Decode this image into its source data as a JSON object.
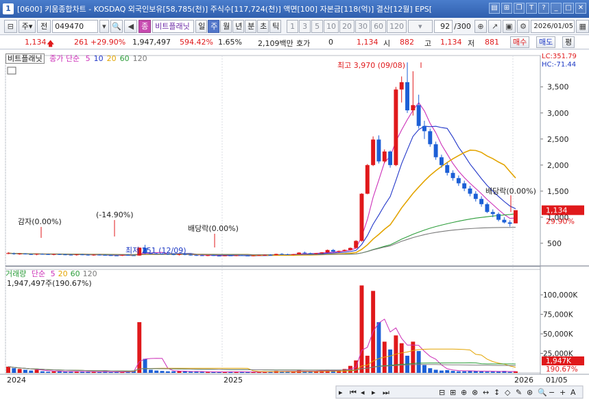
{
  "title": {
    "app_number": "1",
    "text": "[0600] 키움종합차트 - KOSDAQ 외국인보유[58,785(천)] 주식수[117,724(천)] 액면[100] 자본금[118(억)] 결산[12월] EPS["
  },
  "toolbar": {
    "market": "주",
    "prev": "전",
    "code": "049470",
    "name": "비트플래닛",
    "badge": "종",
    "periods": [
      "일",
      "주",
      "월",
      "년",
      "분",
      "초",
      "틱"
    ],
    "selected_period": "주",
    "nums": [
      "1",
      "3",
      "5",
      "10",
      "20",
      "30",
      "60",
      "120"
    ],
    "count": "92",
    "total": "/300",
    "date": "2026/01/05"
  },
  "quote": {
    "price": "1,134",
    "change": "261",
    "change_pct": "+29.90%",
    "volume": "1,947,497",
    "vol_ratio": "594.42%",
    "turnover": "1.65%",
    "amount": "2,109백만",
    "hoga": "호가",
    "hoga_val": "0",
    "ask": "1,134",
    "open_l": "시",
    "open": "882",
    "high_l": "고",
    "high": "1,134",
    "low_l": "저",
    "low": "881",
    "buy": "매수",
    "sell": "매도",
    "avg": "평"
  },
  "legend": {
    "name": "비트플래닛",
    "price_label": "종가 단순",
    "ma": [
      "5",
      "10",
      "20",
      "60",
      "120"
    ],
    "ma_colors": [
      "#cc2fb8",
      "#2237c9",
      "#e3a400",
      "#2c9d3a",
      "#7a7a7a"
    ],
    "lc": "LC:351.79",
    "hc": "HC:-71.44"
  },
  "annotations": {
    "high": "최고 3,970 (09/08)",
    "low": "최저 251 (12/09)",
    "gamja": "감자(0.00%)",
    "minus": "(-14.90%)",
    "div1": "배당락(0.00%)",
    "div2": "배당락(0.00%)"
  },
  "current": {
    "price": "1,134",
    "pct": "29.90%",
    "vol": "1,947K",
    "vol_pct": "190.67%"
  },
  "volume_legend": {
    "label": "거래량",
    "ma_label": "단순",
    "ma": [
      "5",
      "20",
      "60",
      "120"
    ],
    "ma_colors": [
      "#cc2fb8",
      "#e3a400",
      "#2c9d3a",
      "#7a7a7a"
    ],
    "value": "1,947,497주(190.67%)"
  },
  "xaxis": {
    "labels": [
      "2024",
      "2025",
      "2026"
    ],
    "last": "01/05"
  },
  "chart_data": {
    "type": "candlestick",
    "price_ticks": [
      500,
      1000,
      1500,
      2000,
      2500,
      3000,
      3500
    ],
    "ylim_price": [
      130,
      3970
    ],
    "volume_ticks": [
      "25,000K",
      "50,000K",
      "75,000K",
      "100,000K"
    ],
    "ylim_volume_k": [
      0,
      115000
    ],
    "candles": [
      [
        300,
        330,
        290,
        310
      ],
      [
        305,
        320,
        280,
        295
      ],
      [
        295,
        310,
        280,
        300
      ],
      [
        300,
        310,
        285,
        290
      ],
      [
        290,
        300,
        275,
        285
      ],
      [
        285,
        300,
        270,
        295
      ],
      [
        295,
        305,
        280,
        290
      ],
      [
        290,
        300,
        275,
        280
      ],
      [
        280,
        295,
        270,
        290
      ],
      [
        290,
        300,
        275,
        285
      ],
      [
        285,
        295,
        270,
        280
      ],
      [
        280,
        290,
        265,
        275
      ],
      [
        275,
        290,
        262,
        285
      ],
      [
        285,
        295,
        270,
        280
      ],
      [
        280,
        290,
        262,
        270
      ],
      [
        270,
        285,
        260,
        280
      ],
      [
        280,
        290,
        265,
        275
      ],
      [
        275,
        285,
        262,
        270
      ],
      [
        270,
        280,
        258,
        265
      ],
      [
        265,
        275,
        255,
        262
      ],
      [
        262,
        280,
        255,
        275
      ],
      [
        275,
        285,
        260,
        268
      ],
      [
        268,
        278,
        258,
        264
      ],
      [
        264,
        420,
        260,
        415
      ],
      [
        412,
        470,
        290,
        310
      ],
      [
        310,
        325,
        290,
        305
      ],
      [
        305,
        315,
        285,
        300
      ],
      [
        300,
        310,
        280,
        295
      ],
      [
        295,
        305,
        275,
        288
      ],
      [
        288,
        300,
        270,
        282
      ],
      [
        282,
        295,
        265,
        290
      ],
      [
        290,
        300,
        270,
        280
      ],
      [
        280,
        290,
        262,
        272
      ],
      [
        272,
        285,
        258,
        268
      ],
      [
        268,
        280,
        255,
        262
      ],
      [
        262,
        275,
        252,
        270
      ],
      [
        270,
        280,
        255,
        260
      ],
      [
        260,
        272,
        251,
        255
      ],
      [
        255,
        268,
        251,
        265
      ],
      [
        265,
        275,
        255,
        260
      ],
      [
        260,
        270,
        252,
        268
      ],
      [
        268,
        278,
        258,
        262
      ],
      [
        262,
        272,
        254,
        258
      ],
      [
        258,
        268,
        250,
        264
      ],
      [
        264,
        275,
        255,
        270
      ],
      [
        270,
        282,
        262,
        276
      ],
      [
        276,
        290,
        265,
        272
      ],
      [
        272,
        300,
        268,
        295
      ],
      [
        295,
        310,
        280,
        288
      ],
      [
        288,
        300,
        275,
        282
      ],
      [
        282,
        295,
        270,
        290
      ],
      [
        290,
        330,
        285,
        320
      ],
      [
        320,
        340,
        300,
        310
      ],
      [
        310,
        320,
        290,
        300
      ],
      [
        300,
        315,
        285,
        308
      ],
      [
        308,
        330,
        300,
        325
      ],
      [
        325,
        380,
        320,
        370
      ],
      [
        370,
        390,
        330,
        340
      ],
      [
        340,
        360,
        320,
        352
      ],
      [
        352,
        380,
        345,
        372
      ],
      [
        372,
        420,
        360,
        410
      ],
      [
        410,
        560,
        400,
        545
      ],
      [
        545,
        1460,
        530,
        1450
      ],
      [
        1450,
        2020,
        1440,
        2000
      ],
      [
        2000,
        2550,
        1980,
        2490
      ],
      [
        2490,
        2570,
        2030,
        2070
      ],
      [
        2070,
        2300,
        2040,
        2260
      ],
      [
        2260,
        2280,
        1950,
        2000
      ],
      [
        2000,
        3500,
        1980,
        3450
      ],
      [
        3450,
        3700,
        3200,
        3590
      ],
      [
        3590,
        3970,
        3000,
        3050
      ],
      [
        3050,
        3800,
        2950,
        3150
      ],
      [
        3150,
        3350,
        2700,
        2750
      ],
      [
        2750,
        2850,
        2500,
        2650
      ],
      [
        2650,
        2700,
        2350,
        2400
      ],
      [
        2400,
        2450,
        2100,
        2150
      ],
      [
        2150,
        2200,
        1950,
        2000
      ],
      [
        2000,
        2050,
        1800,
        1850
      ],
      [
        1850,
        1900,
        1700,
        1750
      ],
      [
        1750,
        1800,
        1600,
        1650
      ],
      [
        1650,
        1700,
        1500,
        1550
      ],
      [
        1550,
        1600,
        1400,
        1450
      ],
      [
        1450,
        1500,
        1300,
        1350
      ],
      [
        1350,
        1400,
        1200,
        1250
      ],
      [
        1250,
        1280,
        1080,
        1100
      ],
      [
        1100,
        1150,
        1000,
        1060
      ],
      [
        1060,
        1090,
        920,
        950
      ],
      [
        950,
        1000,
        880,
        900
      ],
      [
        900,
        940,
        820,
        873
      ],
      [
        882,
        1134,
        881,
        1134
      ]
    ],
    "volume_k": [
      8000,
      6000,
      5000,
      4000,
      3000,
      4000,
      2000,
      1500,
      2000,
      1800,
      1500,
      2000,
      1600,
      1500,
      1400,
      1300,
      1200,
      2000,
      1000,
      900,
      1200,
      2000,
      3000,
      65000,
      18000,
      4000,
      3000,
      2500,
      2000,
      2000,
      2500,
      1800,
      1500,
      1500,
      1300,
      1200,
      1200,
      1500,
      1500,
      1500,
      1200,
      1300,
      1200,
      1100,
      1400,
      1500,
      2000,
      2500,
      2000,
      1800,
      1600,
      3000,
      2500,
      2000,
      2200,
      3000,
      4000,
      3500,
      3000,
      5000,
      9000,
      16000,
      112000,
      22000,
      105000,
      65000,
      40000,
      30000,
      48000,
      38000,
      22000,
      40000,
      28000,
      10000,
      6000,
      4000,
      3000,
      3500,
      2500,
      2000,
      2000,
      3000,
      2500,
      1800,
      1500,
      1600,
      2000,
      2500,
      1200,
      1947
    ]
  }
}
